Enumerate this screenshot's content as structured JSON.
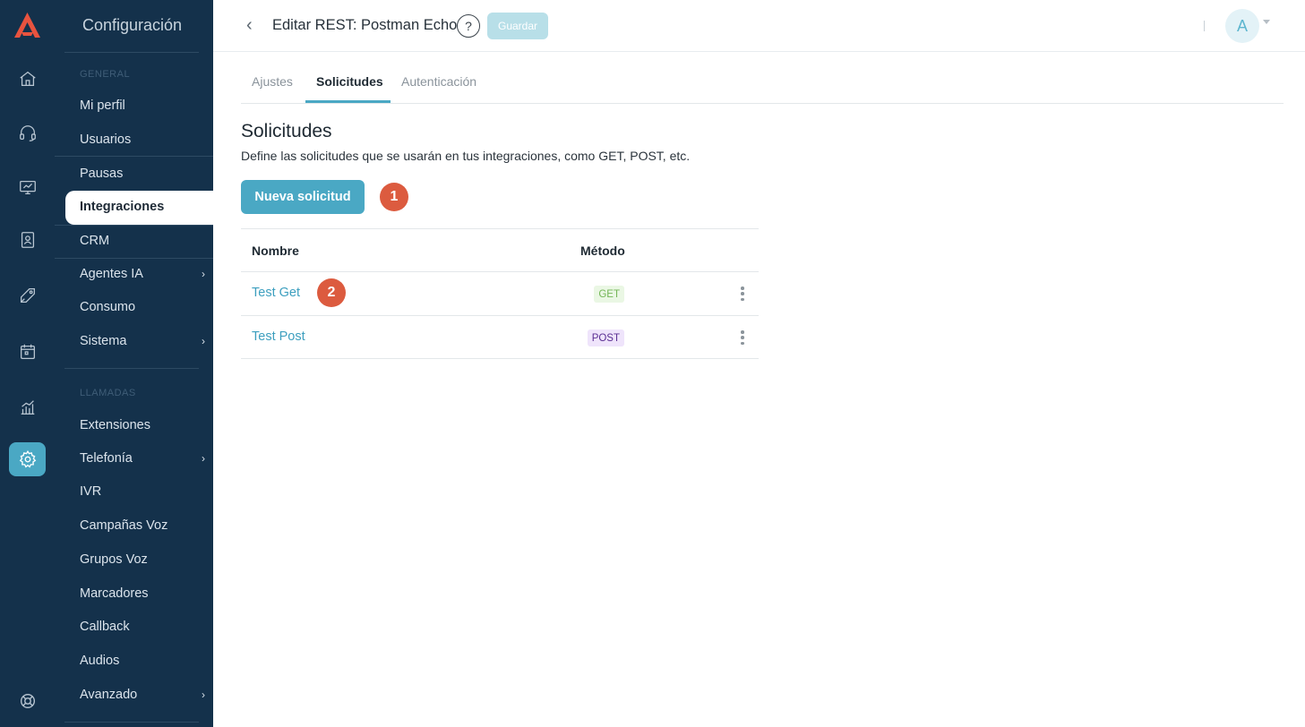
{
  "rail": {
    "icons": [
      "app-logo",
      "home-icon",
      "headset-icon",
      "monitor-icon",
      "contacts-icon",
      "campaign-icon",
      "calendar-icon",
      "analytics-icon",
      "settings-icon",
      "help-lifebuoy-icon"
    ],
    "active": "settings-icon"
  },
  "sidebar": {
    "title": "Configuración",
    "section_general": "GENERAL",
    "general_items": [
      {
        "label": "Mi perfil"
      },
      {
        "label": "Usuarios"
      },
      {
        "label": "Pausas"
      },
      {
        "label": "Integraciones",
        "selected": true
      },
      {
        "label": "CRM"
      },
      {
        "label": "Agentes IA",
        "chevron": "›"
      },
      {
        "label": "Consumo"
      },
      {
        "label": "Sistema",
        "chevron": "›"
      }
    ],
    "section_calls": "LLAMADAS",
    "call_items": [
      {
        "label": "Extensiones"
      },
      {
        "label": "Telefonía",
        "chevron": "›"
      },
      {
        "label": "IVR"
      },
      {
        "label": "Campañas Voz"
      },
      {
        "label": "Grupos Voz"
      },
      {
        "label": "Marcadores"
      },
      {
        "label": "Callback"
      },
      {
        "label": "Audios"
      },
      {
        "label": "Avanzado",
        "chevron": "›"
      }
    ]
  },
  "header": {
    "back_glyph": "‹",
    "title": "Editar REST: Postman Echo",
    "help_glyph": "?",
    "save_label": "Guardar",
    "avatar_initial": "A"
  },
  "tabs": [
    {
      "label": "Ajustes"
    },
    {
      "label": "Solicitudes",
      "active": true
    },
    {
      "label": "Autenticación"
    }
  ],
  "main": {
    "heading": "Solicitudes",
    "description": "Define las solicitudes que se usarán en tus integraciones, como GET, POST, etc.",
    "new_button": "Nueva solicitud",
    "marker_1": "1",
    "marker_2": "2"
  },
  "table": {
    "col_name": "Nombre",
    "col_method": "Método",
    "rows": [
      {
        "name": "Test Get",
        "method": "GET"
      },
      {
        "name": "Test Post",
        "method": "POST"
      }
    ]
  },
  "colors": {
    "sidebar_bg": "#14314b",
    "accent": "#4aa8c4",
    "marker": "#dc5b3f",
    "get_badge": "#74b657",
    "post_badge": "#5b2f93"
  }
}
